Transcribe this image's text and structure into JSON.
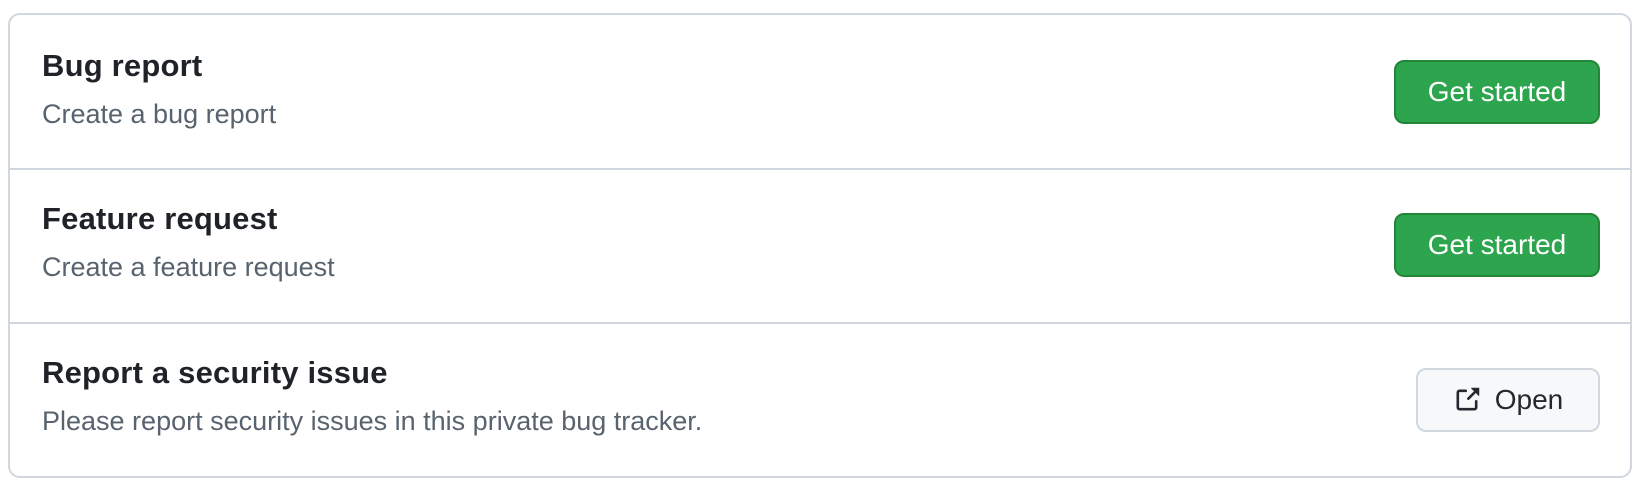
{
  "templates": [
    {
      "title": "Bug report",
      "description": "Create a bug report",
      "button_label": "Get started"
    },
    {
      "title": "Feature request",
      "description": "Create a feature request",
      "button_label": "Get started"
    },
    {
      "title": "Report a security issue",
      "description": "Please report security issues in this private bug tracker.",
      "button_label": "Open",
      "button_icon": "link-external-icon"
    }
  ],
  "colors": {
    "primary_button": "#2da44e",
    "border": "#d0d7de",
    "title_text": "#1f2328",
    "muted_text": "#59636e"
  }
}
